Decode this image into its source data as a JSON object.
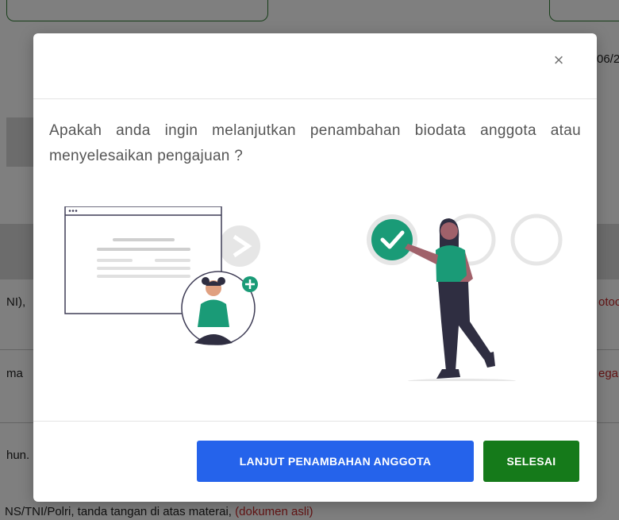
{
  "background": {
    "fragments": [
      {
        "text": "06/2"
      },
      {
        "text": "NI),"
      },
      {
        "text": "otoc"
      },
      {
        "text": "ma"
      },
      {
        "text": "ega"
      },
      {
        "text": "hun."
      }
    ],
    "bottom_text": "NS/TNI/Polri, tanda tangan di atas materai,",
    "bottom_link": "(dokumen asli)"
  },
  "modal": {
    "close_symbol": "×",
    "question": "Apakah anda ingin melanjutkan penambahan biodata anggota atau menyelesaikan pengajuan ?",
    "buttons": {
      "continue_label": "LANJUT PENAMBAHAN ANGGOTA",
      "finish_label": "SELESAI"
    }
  },
  "colors": {
    "primary_button": "#2563eb",
    "success_button": "#157a1a",
    "accent_teal": "#1a9b77"
  }
}
